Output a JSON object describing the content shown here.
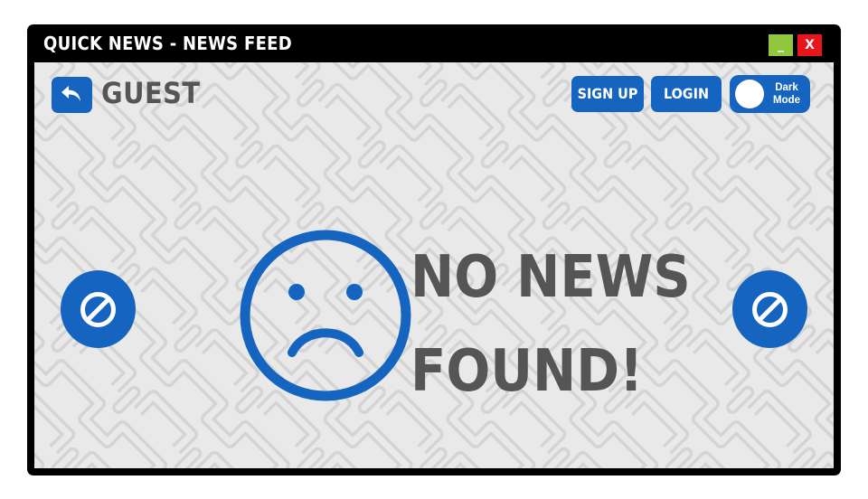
{
  "window": {
    "title": "Quick News - News Feed",
    "minimize_label": "_",
    "close_label": "X"
  },
  "header": {
    "back_icon": "back-arrow-icon",
    "user_label": "Guest",
    "signup_label": "Sign Up",
    "login_label": "Login",
    "dark_mode_label_line1": "Dark",
    "dark_mode_label_line2": "Mode",
    "dark_mode_on": false
  },
  "main": {
    "face_icon": "sad-face-icon",
    "message_line1": "No News",
    "message_line2": "Found!",
    "prev_icon": "disabled-icon",
    "next_icon": "disabled-icon"
  },
  "colors": {
    "accent": "#1565c0",
    "minimize": "#8fc73e",
    "close": "#e8151b",
    "text": "#555555",
    "background": "#e9e9e9",
    "frame": "#000000"
  }
}
